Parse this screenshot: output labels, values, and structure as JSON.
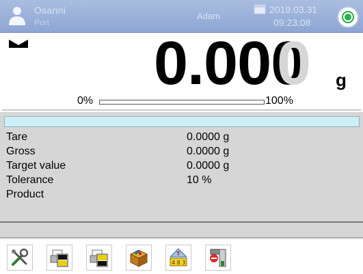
{
  "header": {
    "user_name": "Osanni",
    "user_sub": "Port",
    "mode": "Adam",
    "date": "2019.03.31",
    "time": "09:23:08",
    "user_icon": "user-icon",
    "clock_icon": "date-icon",
    "status_icon": "status-ok-icon",
    "colors": {
      "header_bg": "#9db2dc",
      "status_green": "#27b24a"
    }
  },
  "display": {
    "weight_value": "0.000",
    "weight_ghost_digit": "0",
    "unit": "g",
    "stable_icon": "stable-indicator-icon",
    "range_min_label": "0%",
    "range_max_label": "100%",
    "range_progress": 0
  },
  "info": {
    "rows": [
      {
        "label": "Tare",
        "value": "0.0000 g"
      },
      {
        "label": "Gross",
        "value": "0.0000 g"
      },
      {
        "label": "Target value",
        "value": "0.0000 g"
      },
      {
        "label": "Tolerance",
        "value": "10 %"
      },
      {
        "label": "Product",
        "value": ""
      }
    ]
  },
  "toolbar": {
    "buttons": [
      {
        "icon": "settings-tools-icon"
      },
      {
        "icon": "print-header-icon"
      },
      {
        "icon": "print-footer-icon"
      },
      {
        "icon": "product-database-icon"
      },
      {
        "icon": "target-tolerance-icon"
      },
      {
        "icon": "dosing-icon"
      }
    ]
  }
}
